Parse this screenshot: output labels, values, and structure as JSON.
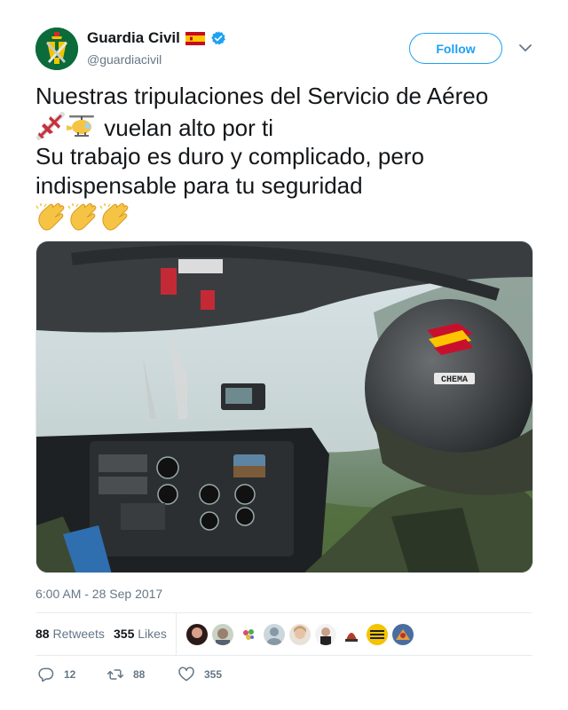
{
  "author": {
    "display_name": "Guardia Civil",
    "handle": "@guardiacivil",
    "verified": true,
    "flag_icon": "spain-flag-icon"
  },
  "follow_label": "Follow",
  "tweet": {
    "lines": [
      "Nuestras tripulaciones del Servicio de Aéreo",
      "vuelan alto por ti",
      "Su trabajo es duro y complicado, pero",
      "indispensable para tu seguridad"
    ],
    "emojis": [
      "airplane-icon",
      "helicopter-icon",
      "clapping-hands-icon"
    ]
  },
  "media": {
    "subject": "helicopter-cockpit-photo",
    "helmet_label": "CHEMA"
  },
  "timestamp": "6:00 AM - 28 Sep 2017",
  "stats": {
    "retweets_count": "88",
    "retweets_label": "Retweets",
    "likes_count": "355",
    "likes_label": "Likes"
  },
  "actions": {
    "reply_count": "12",
    "retweet_count": "88",
    "like_count": "355"
  },
  "colors": {
    "accent": "#1da1f2",
    "muted": "#657786",
    "text": "#14171a"
  }
}
